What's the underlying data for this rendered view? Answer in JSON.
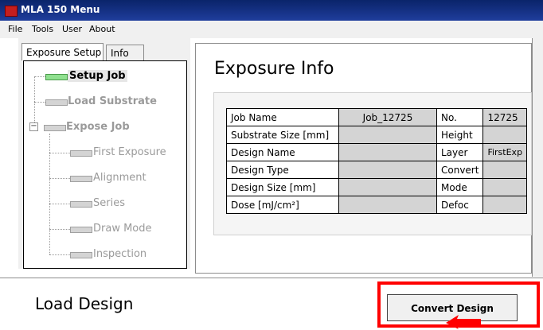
{
  "window": {
    "title": "MLA 150 Menu"
  },
  "menu": [
    "File",
    "Tools",
    "User",
    "About"
  ],
  "tabs": {
    "exposure_setup": "Exposure Setup",
    "info": "Info"
  },
  "tree": {
    "setup_job": "Setup Job",
    "load_substrate": "Load Substrate",
    "expose_job": "Expose Job",
    "expand_toggle": "−",
    "first_exposure": "First Exposure",
    "alignment": "Alignment",
    "series": "Series",
    "draw_mode": "Draw Mode",
    "inspection": "Inspection"
  },
  "exposure_info": {
    "title": "Exposure Info",
    "rows": [
      {
        "label": "Job Name",
        "value": "Job_12725",
        "label2": "No.",
        "value2": "12725"
      },
      {
        "label": "Substrate Size [mm]",
        "value": "",
        "label2": "Height",
        "value2": ""
      },
      {
        "label": "Design Name",
        "value": "",
        "label2": "Layer",
        "value2": "FirstExp"
      },
      {
        "label": "Design Type",
        "value": "",
        "label2": "Convert",
        "value2": ""
      },
      {
        "label": "Design Size [mm]",
        "value": "",
        "label2": "Mode",
        "value2": ""
      },
      {
        "label": "Dose [mJ/cm²]",
        "value": "",
        "label2": "Defoc",
        "value2": ""
      }
    ]
  },
  "load_design": {
    "title": "Load Design",
    "convert_button": "Convert Design"
  },
  "colors": {
    "titlebar": "#0a246a",
    "highlight": "#ff0000",
    "active_node": "#8fe08f"
  }
}
